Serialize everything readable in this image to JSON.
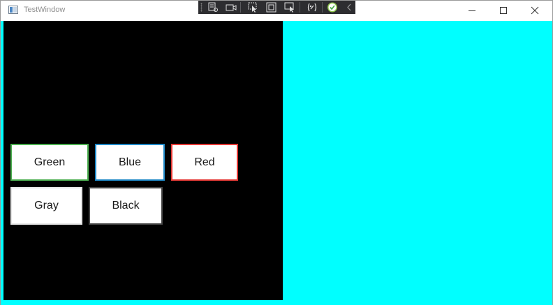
{
  "window": {
    "title": "TestWindow"
  },
  "devtools": {
    "icons": [
      "live-visual-tree-icon",
      "record-icon",
      "select-element-icon",
      "display-layout-adorners-icon",
      "track-focus-icon",
      "binding-failures-icon",
      "hot-reload-status-icon",
      "collapse-toolbar-icon"
    ]
  },
  "buttons": {
    "green": {
      "label": "Green",
      "border_color": "#4caf50"
    },
    "blue": {
      "label": "Blue",
      "border_color": "#1e88c7"
    },
    "red": {
      "label": "Red",
      "border_color": "#e53935"
    },
    "gray": {
      "label": "Gray",
      "border_color": "#e6e6e6"
    },
    "black": {
      "label": "Black",
      "border_color": "#444444"
    }
  },
  "colors": {
    "left_panel": "#000000",
    "right_panel": "#00ffff"
  }
}
